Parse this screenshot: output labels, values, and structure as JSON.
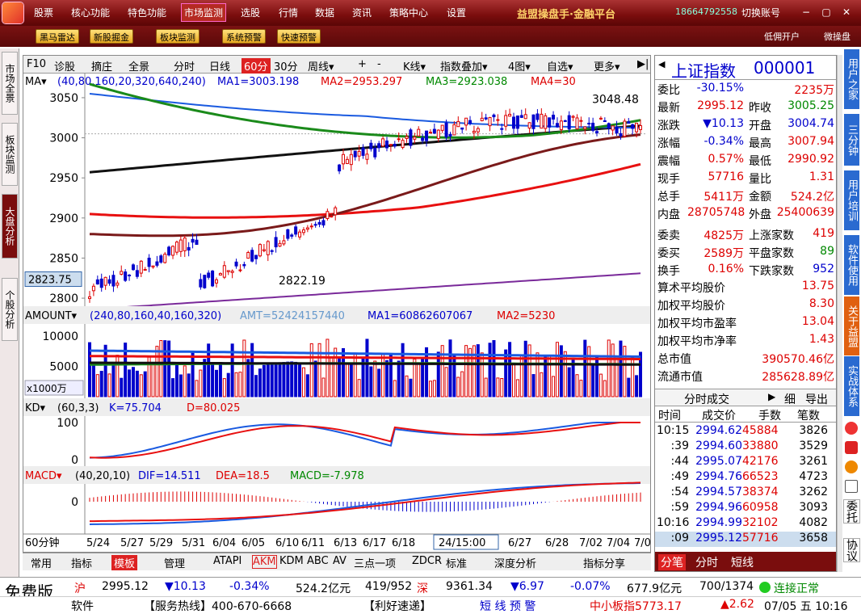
{
  "menu": {
    "items": [
      "股票",
      "核心功能",
      "特色功能",
      "市场监测",
      "选股",
      "行情",
      "数据",
      "资讯",
      "策略中心",
      "设置"
    ],
    "brand": "益盟操盘手·金融平台",
    "phone": "18664792558",
    "switch": "切换账号"
  },
  "toolbar": {
    "buttons": [
      "黑马雷达",
      "新股掘金",
      "板块监测",
      "系统预警",
      "快速预警"
    ],
    "right": [
      "低佣开户",
      "微操盘"
    ]
  },
  "leftbar": {
    "tabs": [
      "市场全景",
      "板块监测",
      "大盘分析",
      "个股分析"
    ]
  },
  "chart_top": {
    "items": [
      "F10",
      "诊股",
      "摘庄",
      "全景",
      "分时",
      "日线",
      "60分",
      "30分",
      "周线▾",
      "+",
      "-",
      "K线▾",
      "指数叠加▾",
      "4图▾",
      "自选▾",
      "更多▾"
    ]
  },
  "ma_legend": {
    "name": "MA▾",
    "params": "(40,80,160,20,320,640,240)",
    "ma1": "MA1=3003.198",
    "ma2": "MA2=2953.297",
    "ma3": "MA3=2923.038",
    "ma4": "MA4=30"
  },
  "price_axis": {
    "ticks": [
      "3050",
      "3000",
      "2950",
      "2900",
      "2850",
      "2800"
    ],
    "cursor": "2823.75"
  },
  "annotations": {
    "high": "3048.48",
    "low": "2822.19"
  },
  "amount_legend": {
    "name": "AMOUNT▾",
    "params": "(240,80,160,40,160,320)",
    "amt": "AMT=52424157440",
    "ma1": "MA1=60862607067",
    "ma2": "MA2=5230"
  },
  "amount_axis": {
    "ticks": [
      "10000",
      "5000"
    ],
    "unit": "x1000万"
  },
  "kd_legend": {
    "name": "KD▾",
    "params": "(60,3,3)",
    "k": "K=75.704",
    "d": "D=80.025"
  },
  "kd_axis": {
    "ticks": [
      "100",
      "0"
    ]
  },
  "macd_legend": {
    "name": "MACD▾",
    "params": "(40,20,10)",
    "dif": "DIF=14.511",
    "dea": "DEA=18.5",
    "macd": "MACD=-7.978"
  },
  "macd_axis": {
    "ticks": [
      "0"
    ]
  },
  "date_axis": {
    "period": "60分钟",
    "dates": [
      "5/24",
      "5/27",
      "5/29",
      "5/31",
      "6/04",
      "6/05",
      "6/10",
      "6/11",
      "6/13",
      "6/17",
      "6/18",
      "24/15:00",
      "6/27",
      "6/28",
      "7/02",
      "7/04",
      "7/0"
    ]
  },
  "bottom_tabs": {
    "items": [
      "常用",
      "指标",
      "模板",
      "管理",
      "ATAPI",
      "AKM",
      "KDM",
      "ABC",
      "AV",
      "三点一项",
      "ZDCR",
      "标准",
      "深度分析",
      "指标分享"
    ]
  },
  "quote": {
    "title": "上证指数",
    "code": "000001",
    "rows": [
      [
        "委比",
        "-30.15%",
        "",
        "2235万"
      ],
      [
        "最新",
        "2995.12",
        "昨收",
        "3005.25"
      ],
      [
        "涨跌",
        "▼10.13",
        "开盘",
        "3004.74"
      ],
      [
        "涨幅",
        "-0.34%",
        "最高",
        "3007.94"
      ],
      [
        "震幅",
        "0.57%",
        "最低",
        "2990.92"
      ],
      [
        "现手",
        "57716",
        "量比",
        "1.31"
      ],
      [
        "总手",
        "5411万",
        "金额",
        "524.2亿"
      ],
      [
        "内盘",
        "28705748",
        "外盘",
        "25400639"
      ],
      [
        "委卖",
        "4825万",
        "上涨家数",
        "419"
      ],
      [
        "委买",
        "2589万",
        "平盘家数",
        "89"
      ],
      [
        "换手",
        "0.16%",
        "下跌家数",
        "952"
      ]
    ],
    "stats": [
      [
        "算术平均股价",
        "13.75"
      ],
      [
        "加权平均股价",
        "8.30"
      ],
      [
        "加权平均市盈率",
        "13.04"
      ],
      [
        "加权平均市净率",
        "1.43"
      ],
      [
        "总市值",
        "390570.46亿"
      ],
      [
        "流通市值",
        "285628.89亿"
      ]
    ],
    "tick_header": "分时成交",
    "tick_btns": [
      "细",
      "导出"
    ],
    "tick_cols": [
      "时间",
      "成交价",
      "手数",
      "笔数"
    ],
    "ticks": [
      [
        "10:15",
        "2994.62",
        "45884",
        "3826"
      ],
      [
        ":39",
        "2994.60",
        "33880",
        "3529"
      ],
      [
        ":44",
        "2995.07",
        "42176",
        "3261"
      ],
      [
        ":49",
        "2994.76",
        "66523",
        "4723"
      ],
      [
        ":54",
        "2994.57",
        "38374",
        "3262"
      ],
      [
        ":59",
        "2994.96",
        "60958",
        "3093"
      ],
      [
        "10:16",
        "2994.99",
        "32102",
        "4082"
      ],
      [
        ":09",
        "2995.12",
        "57716",
        "3658"
      ]
    ],
    "bottom": [
      "分笔",
      "分时",
      "短线"
    ]
  },
  "rightbar": {
    "tabs": [
      "用户之家",
      "三分钟",
      "用户培训",
      "软件使用",
      "关于益盟",
      "实战体系",
      "委托",
      "协议"
    ]
  },
  "status1": {
    "badge": "免费版",
    "sh_label": "沪",
    "sh_price": "2995.12",
    "sh_chg": "▼10.13",
    "sh_pct": "-0.34%",
    "sh_amt": "524.2亿元",
    "sh_cnt": "419/952",
    "sz_label": "深",
    "sz_price": "9361.34",
    "sz_chg": "▼6.97",
    "sz_pct": "-0.07%",
    "sz_amt": "677.9亿元",
    "sz_cnt": "700/1374",
    "conn": "连接正常"
  },
  "status2": {
    "soft": "软件",
    "hotline": "【服务热线】400-670-6668",
    "news": "【利好速递】",
    "alert": "短 线 预 警",
    "sme": "中小板指5773.17",
    "sme_chg": "▲2.62",
    "date": "07/05 五 10:16"
  },
  "colors": {
    "menubar": "#7a0d0d",
    "up": "#dd0000",
    "down": "#0000cc",
    "ma_black": "#111111",
    "ma_blue": "#1a5ae0",
    "ma_green": "#1a8a1a",
    "ma_red": "#e81010",
    "ma_brown": "#7a1a1a",
    "ma_purple": "#7a2a9a"
  }
}
